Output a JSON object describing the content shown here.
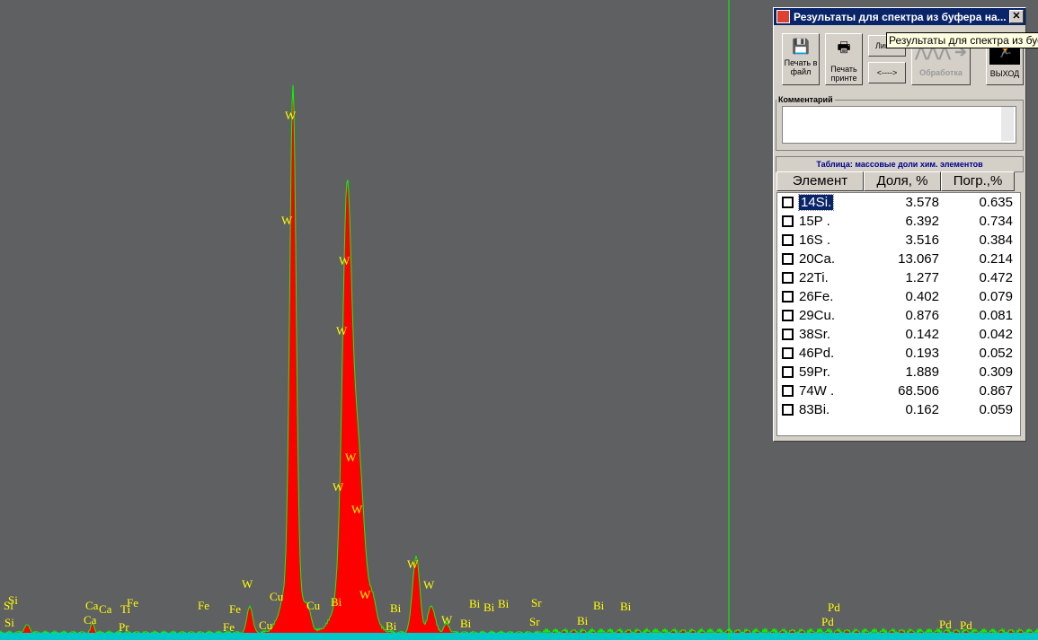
{
  "spectrum": {
    "colors": {
      "background": "#5f6062",
      "peak_fill": "#ff0000",
      "outline": "#00ff00",
      "baseline": "#00c8c8",
      "marker": "#00ff00",
      "labels": "#ffff00"
    },
    "labels": [
      "W",
      "W",
      "W",
      "W",
      "W",
      "W",
      "W",
      "W",
      "W",
      "W",
      "W",
      "W",
      "Bi",
      "Bi",
      "Bi",
      "Bi",
      "Bi",
      "Bi",
      "Bi",
      "Bi",
      "Sr",
      "Sr",
      "Bi",
      "Bi",
      "Pd",
      "Pd",
      "Pd",
      "Pd",
      "Cu",
      "Cu",
      "Cu",
      "Ca",
      "Ca",
      "Ca",
      "Ti",
      "Pr",
      "Fe",
      "Fe",
      "Fe",
      "Fe",
      "Si",
      "Si",
      "Si"
    ]
  },
  "window": {
    "title": "Результаты для спектра из буфера на...",
    "tooltip": "Результаты для спектра из буфера на...",
    "buttons": {
      "print_file": "Печать в файл",
      "print_printer": "Печать принте",
      "lines": "Линии",
      "arrows": "<---->",
      "processing": "Обработка",
      "exit": "ВЫХОД"
    },
    "comment_label": "Комментарий",
    "comment_value": "",
    "table_title": "Таблица: массовые доли хим. элементов",
    "columns": [
      "Элемент",
      "Доля, %",
      "Погр.,%"
    ],
    "rows": [
      [
        "14Si.",
        "3.578",
        "0.635"
      ],
      [
        "15P .",
        "6.392",
        "0.734"
      ],
      [
        "16S .",
        "3.516",
        "0.384"
      ],
      [
        "20Ca.",
        "13.067",
        "0.214"
      ],
      [
        "22Ti.",
        "1.277",
        "0.472"
      ],
      [
        "26Fe.",
        "0.402",
        "0.079"
      ],
      [
        "29Cu.",
        "0.876",
        "0.081"
      ],
      [
        "38Sr.",
        "0.142",
        "0.042"
      ],
      [
        "46Pd.",
        "0.193",
        "0.052"
      ],
      [
        "59Pr.",
        "1.889",
        "0.309"
      ],
      [
        "74W .",
        "68.506",
        "0.867"
      ],
      [
        "83Bi.",
        "0.162",
        "0.059"
      ]
    ],
    "selected_row": 0
  }
}
